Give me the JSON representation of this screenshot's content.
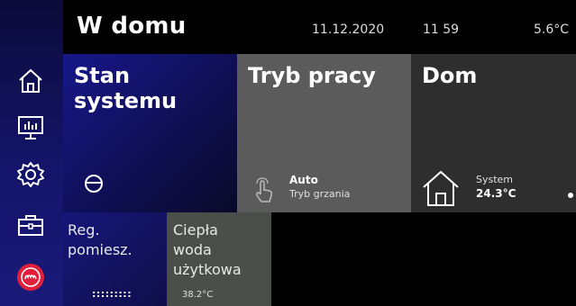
{
  "header": {
    "title": "W domu",
    "date": "11.12.2020",
    "time": "11 59",
    "outdoor_temp": "5.6°C"
  },
  "sidebar": {
    "items": [
      {
        "name": "home",
        "icon": "home-icon"
      },
      {
        "name": "statistics",
        "icon": "chart-monitor-icon"
      },
      {
        "name": "settings",
        "icon": "gear-icon"
      },
      {
        "name": "service",
        "icon": "toolbox-icon"
      },
      {
        "name": "brand",
        "icon": "brand-logo-icon"
      }
    ]
  },
  "tiles": {
    "stan": {
      "title_line1": "Stan",
      "title_line2": "systemu",
      "icon": "compressor-icon"
    },
    "tryb": {
      "title": "Tryb pracy",
      "mode": "Auto",
      "mode_sub": "Tryb grzania",
      "icon": "touch-icon"
    },
    "dom": {
      "title": "Dom",
      "label": "System",
      "value": "24.3°C",
      "icon": "house-icon"
    },
    "reg": {
      "line1": "Reg.",
      "line2": "pomiesz.",
      "dots": ":::::::::"
    },
    "woda": {
      "line1": "Ciepła",
      "line2": "woda",
      "line3": "użytkowa",
      "value": "38.2°C"
    }
  },
  "colors": {
    "sidebar": "#14146a",
    "tile_stan": "#17178a",
    "tile_tryb": "#5b5b5b",
    "tile_dom": "#2e2e2e",
    "tile_woda": "#4a4f4a",
    "brand_red": "#e0203a"
  }
}
